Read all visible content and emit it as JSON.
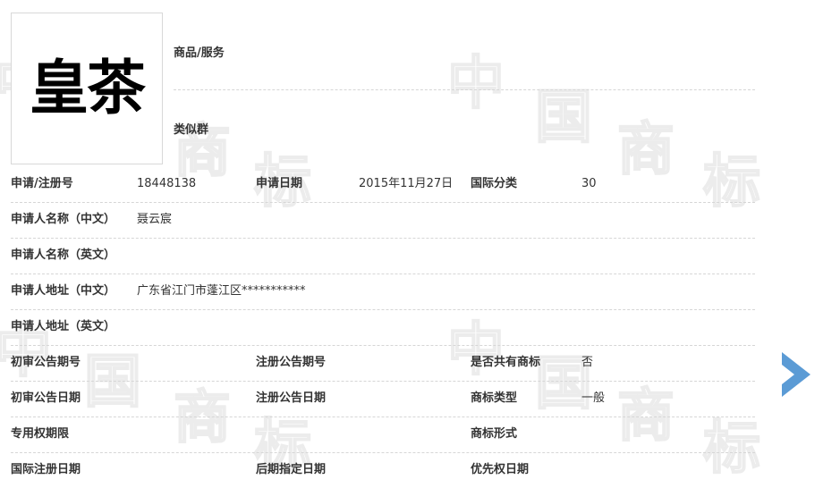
{
  "trademark": {
    "logo_text": "皇茶"
  },
  "goods_services": {
    "label": "商品/服务",
    "similar_group_label": "类似群"
  },
  "details": {
    "reg_no_label": "申请/注册号",
    "reg_no": "18448138",
    "apply_date_label": "申请日期",
    "apply_date": "2015年11月27日",
    "intl_class_label": "国际分类",
    "intl_class": "30",
    "applicant_cn_label": "申请人名称（中文）",
    "applicant_cn": "聂云宸",
    "applicant_en_label": "申请人名称（英文）",
    "address_cn_label": "申请人地址（中文）",
    "address_cn": "广东省江门市蓬江区***********",
    "address_en_label": "申请人地址（英文）",
    "prelim_pub_no_label": "初审公告期号",
    "reg_pub_no_label": "注册公告期号",
    "shared_label": "是否共有商标",
    "shared": "否",
    "prelim_pub_date_label": "初审公告日期",
    "reg_pub_date_label": "注册公告日期",
    "tm_type_label": "商标类型",
    "tm_type": "一般",
    "exclusive_period_label": "专用权期限",
    "tm_form_label": "商标形式",
    "intl_reg_date_label": "国际注册日期",
    "later_designation_label": "后期指定日期",
    "priority_date_label": "优先权日期"
  },
  "watermark": {
    "chars": [
      "中",
      "国",
      "商",
      "标"
    ],
    "color": "#ececec"
  },
  "colors": {
    "arrow": "#5b9bd5"
  }
}
